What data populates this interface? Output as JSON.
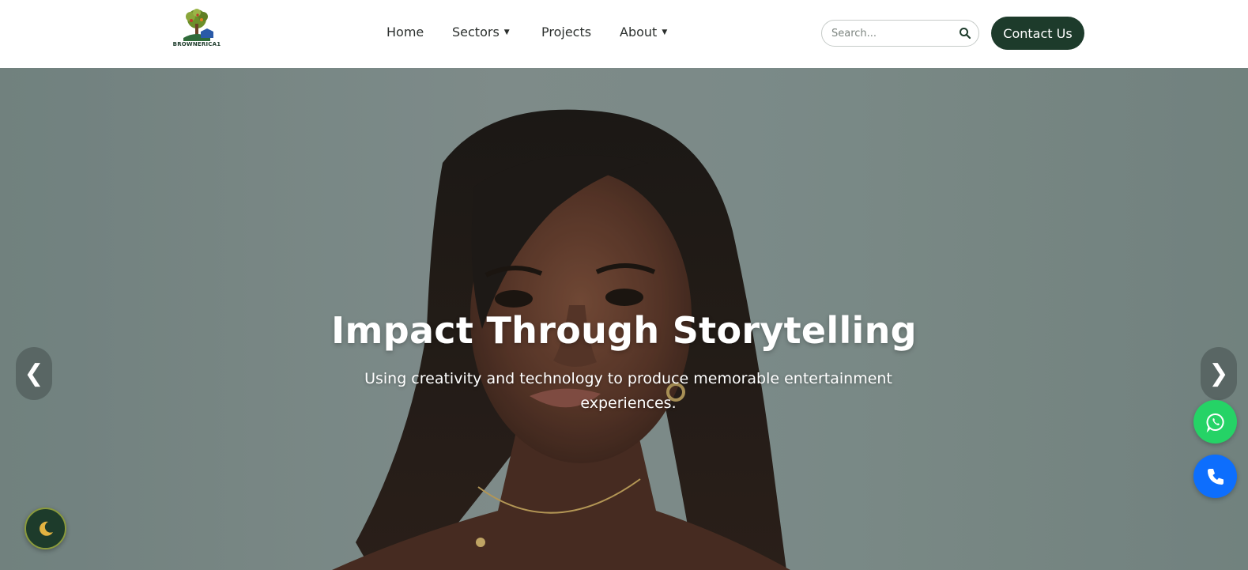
{
  "brand": {
    "name": "BROWNERICA1",
    "logo_icon": "tree-logo-icon"
  },
  "nav": {
    "items": [
      {
        "label": "Home",
        "has_dropdown": false
      },
      {
        "label": "Sectors",
        "has_dropdown": true
      },
      {
        "label": "Projects",
        "has_dropdown": false
      },
      {
        "label": "About",
        "has_dropdown": true
      }
    ],
    "caret": "▼"
  },
  "search": {
    "placeholder": "Search...",
    "value": "",
    "icon": "search-icon"
  },
  "contact_button": {
    "label": "Contact Us"
  },
  "hero": {
    "title": "Impact Through Storytelling",
    "subtitle": "Using creativity and technology to produce memorable entertainment experiences.",
    "prev_label": "❮",
    "next_label": "❯"
  },
  "floating": {
    "whatsapp_icon": "whatsapp-icon",
    "phone_icon": "phone-icon",
    "theme_icon": "moon-icon"
  },
  "colors": {
    "brand_dark_green": "#1d3b2b",
    "whatsapp_green": "#25d366",
    "phone_blue": "#0d6efd",
    "moon_gold": "#e3b341"
  }
}
